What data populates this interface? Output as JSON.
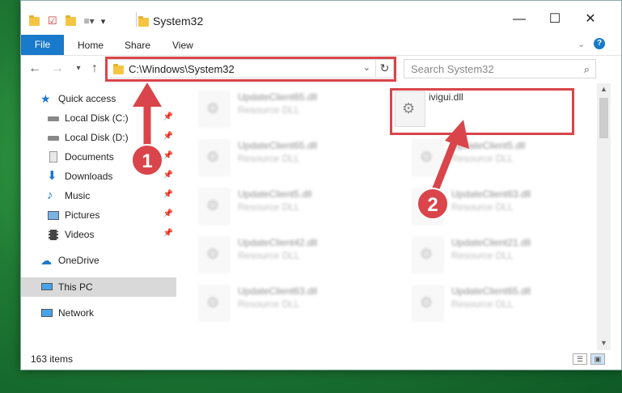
{
  "window": {
    "title": "System32",
    "controls": {
      "minimize": "—",
      "maximize": "☐",
      "close": "✕"
    }
  },
  "menu": {
    "file": "File",
    "home": "Home",
    "share": "Share",
    "view": "View"
  },
  "address": {
    "path": "C:\\Windows\\System32",
    "search_placeholder": "Search System32"
  },
  "sidebar": {
    "items": [
      {
        "label": "Quick access",
        "icon": "star-icon",
        "pinned": false
      },
      {
        "label": "Local Disk (C:)",
        "icon": "drive-icon",
        "pinned": true
      },
      {
        "label": "Local Disk (D:)",
        "icon": "drive-icon",
        "pinned": true
      },
      {
        "label": "Documents",
        "icon": "documents-icon",
        "pinned": true
      },
      {
        "label": "Downloads",
        "icon": "download-icon",
        "pinned": true
      },
      {
        "label": "Music",
        "icon": "music-icon",
        "pinned": true
      },
      {
        "label": "Pictures",
        "icon": "pictures-icon",
        "pinned": true
      },
      {
        "label": "Videos",
        "icon": "videos-icon",
        "pinned": true
      },
      {
        "label": "OneDrive",
        "icon": "cloud-icon",
        "pinned": false
      },
      {
        "label": "This PC",
        "icon": "computer-icon",
        "pinned": false,
        "selected": true
      },
      {
        "label": "Network",
        "icon": "network-icon",
        "pinned": false
      }
    ]
  },
  "files": [
    {
      "name": "UpdateClient65.dll",
      "type": "Resource DLL"
    },
    {
      "name": "ivigui.dll",
      "type": ""
    },
    {
      "name": "UpdateClient65.dll",
      "type": "Resource DLL"
    },
    {
      "name": "UpdateClient5.dll",
      "type": "Resource DLL"
    },
    {
      "name": "UpdateClient5.dll",
      "type": "Resource DLL"
    },
    {
      "name": "UpdateClient63.dll",
      "type": "Resource DLL"
    },
    {
      "name": "UpdateClient42.dll",
      "type": "Resource DLL"
    },
    {
      "name": "UpdateClient21.dll",
      "type": "Resource DLL"
    },
    {
      "name": "UpdateClient63.dll",
      "type": "Resource DLL"
    },
    {
      "name": "UpdateClient65.dll",
      "type": "Resource DLL"
    }
  ],
  "status": {
    "items": "163 items"
  },
  "annotations": [
    {
      "label": "1"
    },
    {
      "label": "2"
    }
  ],
  "colors": {
    "accent": "#1979ca",
    "highlight": "#d9454a"
  }
}
